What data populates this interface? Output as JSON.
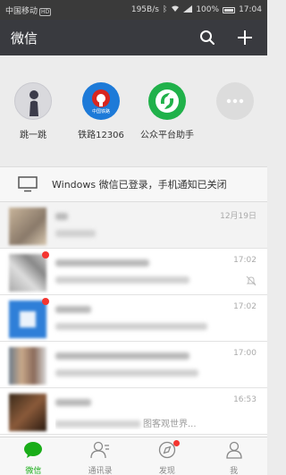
{
  "status_bar": {
    "carrier": "中国移动",
    "network_badge": "HD",
    "speed": "195B/s",
    "battery": "100%",
    "time": "17:04"
  },
  "header": {
    "title": "微信",
    "search_icon": "search-icon",
    "add_icon": "plus-icon"
  },
  "shortcuts": [
    {
      "label": "跳一跳",
      "icon": "jump-game-icon"
    },
    {
      "label": "铁路12306",
      "icon": "railway-icon",
      "badge_text": "中国铁路"
    },
    {
      "label": "公众平台助手",
      "icon": "mp-assistant-icon"
    },
    {
      "label": "",
      "icon": "more-icon"
    }
  ],
  "notice": {
    "text": "Windows 微信已登录，手机通知已关闭",
    "icon": "monitor-icon"
  },
  "chats": [
    {
      "time": "12月19日",
      "preview": ""
    },
    {
      "time": "17:02",
      "preview": "",
      "muted": true,
      "unread": true
    },
    {
      "time": "17:02",
      "preview": "",
      "unread": true
    },
    {
      "time": "17:00",
      "preview": ""
    },
    {
      "time": "16:53",
      "preview": "图客观世界..."
    }
  ],
  "tabs": [
    {
      "label": "微信",
      "icon": "chat-icon",
      "active": true
    },
    {
      "label": "通讯录",
      "icon": "contacts-icon"
    },
    {
      "label": "发现",
      "icon": "compass-icon",
      "dot": true
    },
    {
      "label": "我",
      "icon": "person-icon"
    }
  ],
  "colors": {
    "accent": "#1aad19",
    "header_bg": "#393a3f",
    "badge_red": "#f43530"
  }
}
